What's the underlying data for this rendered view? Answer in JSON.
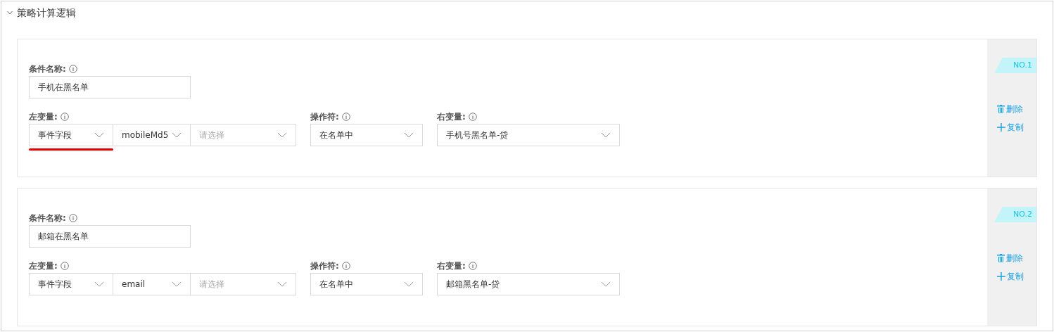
{
  "section": {
    "title": "策略计算逻辑",
    "expanded": true
  },
  "conditions": [
    {
      "badge": "NO.1",
      "name_label": "条件名称:",
      "name_value": "手机在黑名单",
      "left_label": "左变量:",
      "left_underlined": true,
      "left_selects": [
        {
          "value": "事件字段"
        },
        {
          "value": "mobileMd5"
        },
        {
          "placeholder": "请选择"
        }
      ],
      "operator_label": "操作符:",
      "operator": {
        "value": "在名单中"
      },
      "right_label": "右变量:",
      "right": {
        "value": "手机号黑名单-贷"
      },
      "actions": [
        {
          "kind": "delete",
          "label": "删除"
        },
        {
          "kind": "copy",
          "label": "复制"
        }
      ]
    },
    {
      "badge": "NO.2",
      "name_label": "条件名称:",
      "name_value": "邮箱在黑名单",
      "left_label": "左变量:",
      "left_underlined": false,
      "left_selects": [
        {
          "value": "事件字段"
        },
        {
          "value": "email"
        },
        {
          "placeholder": "请选择"
        }
      ],
      "operator_label": "操作符:",
      "operator": {
        "value": "在名单中"
      },
      "right_label": "右变量:",
      "right": {
        "value": "邮箱黑名单-贷"
      },
      "actions": [
        {
          "kind": "delete",
          "label": "删除"
        },
        {
          "kind": "copy",
          "label": "复制"
        }
      ]
    }
  ]
}
